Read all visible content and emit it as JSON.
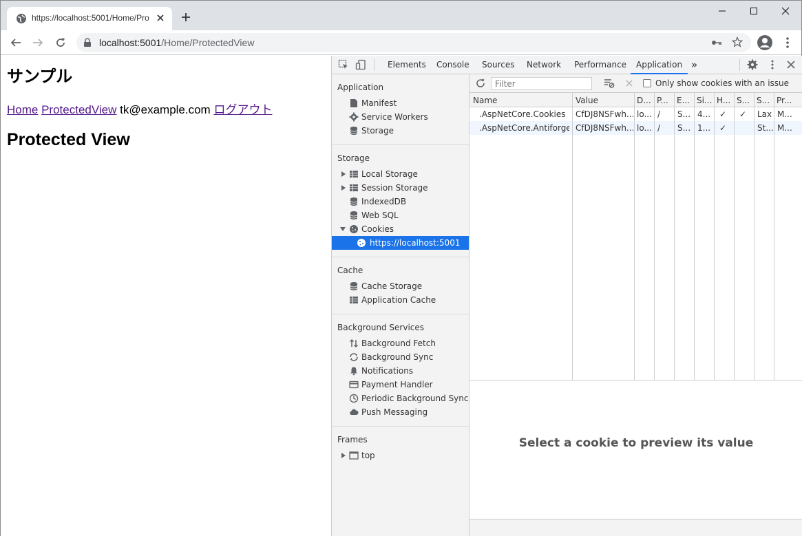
{
  "browser": {
    "tab": {
      "title": "https://localhost:5001/Home/Pro"
    },
    "address": {
      "host": "localhost:5001",
      "path": "/Home/ProtectedView"
    }
  },
  "page": {
    "heading": "サンプル",
    "nav": {
      "home": "Home",
      "protected": "ProtectedView",
      "user": "tk@example.com",
      "logout": "ログアウト"
    },
    "subheading": "Protected View"
  },
  "devtools": {
    "tabs": [
      "Elements",
      "Console",
      "Sources",
      "Network",
      "Performance",
      "Application"
    ],
    "active_tab": "Application",
    "more_tabs": "»",
    "sidebar": {
      "application": {
        "title": "Application",
        "items": [
          "Manifest",
          "Service Workers",
          "Storage"
        ]
      },
      "storage": {
        "title": "Storage",
        "items": [
          "Local Storage",
          "Session Storage",
          "IndexedDB",
          "Web SQL",
          "Cookies"
        ],
        "cookie_origin": "https://localhost:5001"
      },
      "cache": {
        "title": "Cache",
        "items": [
          "Cache Storage",
          "Application Cache"
        ]
      },
      "background": {
        "title": "Background Services",
        "items": [
          "Background Fetch",
          "Background Sync",
          "Notifications",
          "Payment Handler",
          "Periodic Background Sync",
          "Push Messaging"
        ]
      },
      "frames": {
        "title": "Frames",
        "items": [
          "top"
        ]
      }
    },
    "filter": {
      "placeholder": "Filter",
      "issue_label": "Only show cookies with an issue"
    },
    "cookies": {
      "columns": [
        "Name",
        "Value",
        "D...",
        "P...",
        "E...",
        "Si...",
        "H...",
        "S...",
        "S...",
        "Pr..."
      ],
      "rows": [
        [
          ".AspNetCore.Cookies",
          "CfDJ8NSFwh...",
          "lo...",
          "/",
          "S...",
          "4...",
          "✓",
          "✓",
          "Lax",
          "M..."
        ],
        [
          ".AspNetCore.Antiforge...",
          "CfDJ8NSFwh...",
          "lo...",
          "/",
          "S...",
          "1...",
          "✓",
          "",
          "St...",
          "M..."
        ]
      ]
    },
    "preview_message": "Select a cookie to preview its value"
  }
}
